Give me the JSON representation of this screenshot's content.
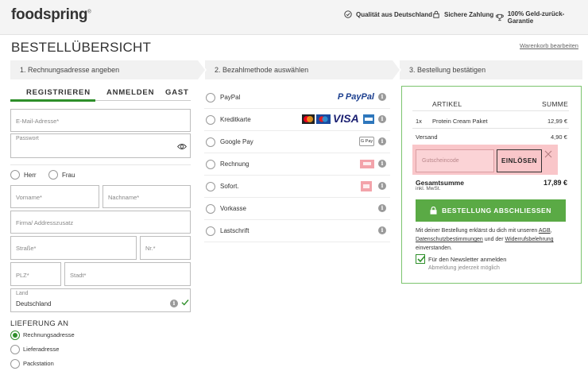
{
  "header": {
    "logo_text": "foodspring",
    "logo_mark": "®",
    "trust_items": [
      {
        "label": "Qualität aus Deutschland",
        "icon": "check-circle-icon"
      },
      {
        "label": "Sichere Zahlung",
        "icon": "lock-icon"
      },
      {
        "label": "100% Geld-zurück-Garantie",
        "icon": "trophy-icon"
      }
    ]
  },
  "page": {
    "title": "BESTELLÜBERSICHT",
    "edit_cart": "Warenkorb bearbeiten"
  },
  "steps": [
    {
      "label": "1. Rechnungsadresse angeben"
    },
    {
      "label": "2. Bezahlmethode auswählen"
    },
    {
      "label": "3. Bestellung bestätigen"
    }
  ],
  "tabs": [
    {
      "label": "REGISTRIEREN",
      "active": true
    },
    {
      "label": "ANMELDEN",
      "active": false
    },
    {
      "label": "GAST",
      "active": false
    }
  ],
  "form": {
    "email_placeholder": "E-Mail-Adresse*",
    "password_label": "Passwort",
    "salutation": [
      {
        "label": "Herr"
      },
      {
        "label": "Frau"
      }
    ],
    "first_name_placeholder": "Vorname*",
    "last_name_placeholder": "Nachname*",
    "company_placeholder": "Firma/ Addresszusatz",
    "street_placeholder": "Straße*",
    "number_placeholder": "Nr.*",
    "zip_placeholder": "PLZ*",
    "city_placeholder": "Stadt*",
    "country_label": "Land",
    "country_value": "Deutschland"
  },
  "delivery": {
    "heading": "LIEFERUNG AN",
    "options": [
      {
        "label": "Rechnungsadresse",
        "selected": true
      },
      {
        "label": "Lieferadresse",
        "selected": false
      },
      {
        "label": "Packstation",
        "selected": false
      }
    ]
  },
  "payment": {
    "methods": [
      {
        "label": "PayPal",
        "logo": "paypal-logo"
      },
      {
        "label": "Kreditkarte",
        "logo": "card-logos"
      },
      {
        "label": "Google Pay",
        "logo": "gpay-logo",
        "logo_text": "G Pay"
      },
      {
        "label": "Rechnung",
        "logo": "invoice-logo"
      },
      {
        "label": "Sofort.",
        "logo": "sofort-logo"
      },
      {
        "label": "Vorkasse",
        "logo": ""
      },
      {
        "label": "Lastschrift",
        "logo": ""
      }
    ],
    "paypal_text": "PayPal",
    "visa_text": "VISA",
    "info_glyph": "i"
  },
  "summary": {
    "col_article": "ARTIKEL",
    "col_sum": "SUMME",
    "items": [
      {
        "qty": "1x",
        "name": "Protein Cream Paket",
        "price": "12,99 €"
      }
    ],
    "shipping_label": "Versand",
    "shipping_value": "4,90 €",
    "coupon_placeholder": "Gutscheincode",
    "coupon_button": "EINLÖSEN",
    "total_label": "Gesamtsumme",
    "total_sub": "inkl. MwSt.",
    "total_value": "17,89 €",
    "order_button": "BESTELLUNG ABSCHLIESSEN",
    "legal_1": "Mit deiner Bestellung erklärst du dich mit unseren",
    "legal_agb": "AGB",
    "legal_comma": ",",
    "legal_privacy": "Datenschutzbestimmungen",
    "legal_and": "und der",
    "legal_withdrawal": "Widerrufsbelehrung",
    "legal_end": "einverstanden.",
    "newsletter_label": "Für den Newsletter anmelden",
    "newsletter_checked": true,
    "newsletter_hint": "Abmeldung jederzeit möglich"
  },
  "colors": {
    "accent": "#2e8f2a",
    "button": "#5aaa45",
    "coupon_highlight": "#f9c6c9"
  }
}
